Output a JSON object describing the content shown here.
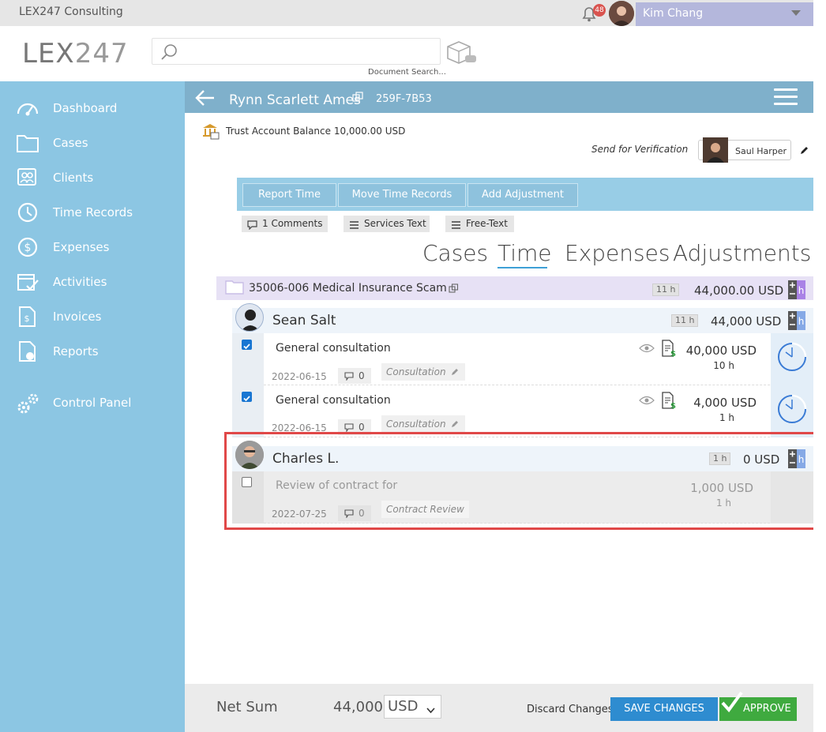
{
  "topbar": {
    "company": "LEX247 Consulting",
    "notification_count": "48",
    "user_name": "Kim Chang"
  },
  "header": {
    "logo_bold": "LEX",
    "logo_thin": "247",
    "search_placeholder": "",
    "search_caption": "Document Search..."
  },
  "sidebar": {
    "items": [
      {
        "label": "Dashboard",
        "icon": "gauge-icon"
      },
      {
        "label": "Cases",
        "icon": "folder-icon"
      },
      {
        "label": "Clients",
        "icon": "clients-icon"
      },
      {
        "label": "Time Records",
        "icon": "clock-icon"
      },
      {
        "label": "Expenses",
        "icon": "dollar-icon"
      },
      {
        "label": "Activities",
        "icon": "calendar-check-icon"
      },
      {
        "label": "Invoices",
        "icon": "invoice-icon"
      },
      {
        "label": "Reports",
        "icon": "report-icon"
      },
      {
        "label": "Control Panel",
        "icon": "gears-icon"
      }
    ]
  },
  "invoice": {
    "client_name": "Rynn Scarlett Ames",
    "client_code": "259F-7B53",
    "trust_text": "Trust Account Balance 10,000.00 USD",
    "send_verification": "Send for Verification",
    "approver_name": "Saul Harper"
  },
  "actions": {
    "report_time": "Report Time",
    "move_time": "Move Time Records",
    "add_adjustment": "Add Adjustment",
    "comments": "1 Comments",
    "services_text": "Services Text",
    "free_text": "Free-Text"
  },
  "tabs": {
    "cases": "Cases",
    "time": "Time",
    "expenses": "Expenses",
    "adjustments": "Adjustments",
    "active": "Time"
  },
  "case": {
    "name": "35006-006 Medical Insurance Scam",
    "hours": "11 h",
    "sum": "44,000.00 USD",
    "h_label": "h"
  },
  "employees": [
    {
      "name": "Sean Salt",
      "hours": "11 h",
      "sum": "44,000 USD",
      "entries": [
        {
          "checked": true,
          "title": "General consultation",
          "date": "2022-06-15",
          "comments": "0",
          "tag": "Consultation",
          "amount": "40,000 USD",
          "hours": "10 h"
        },
        {
          "checked": true,
          "title": "General consultation",
          "date": "2022-06-15",
          "comments": "0",
          "tag": "Consultation",
          "amount": "4,000 USD",
          "hours": "1 h"
        }
      ]
    },
    {
      "name": "Charles L.",
      "hours": "1 h",
      "sum": "0 USD",
      "entries": [
        {
          "checked": false,
          "title": "Review of contract for",
          "date": "2022-07-25",
          "comments": "0",
          "tag": "Contract Review",
          "amount": "1,000 USD",
          "hours": "1 h"
        }
      ]
    }
  ],
  "footer": {
    "net_sum_label": "Net Sum",
    "net_sum_value": "44,000",
    "currency": "USD",
    "discard": "Discard Changes",
    "save": "SAVE CHANGES",
    "approve": "APPROVE"
  },
  "colors": {
    "sidebar": "#8cc6e3",
    "header_band": "#7fb0cb",
    "save": "#2e8cd0",
    "approve": "#3faa3f",
    "highlight": "#e04848"
  }
}
